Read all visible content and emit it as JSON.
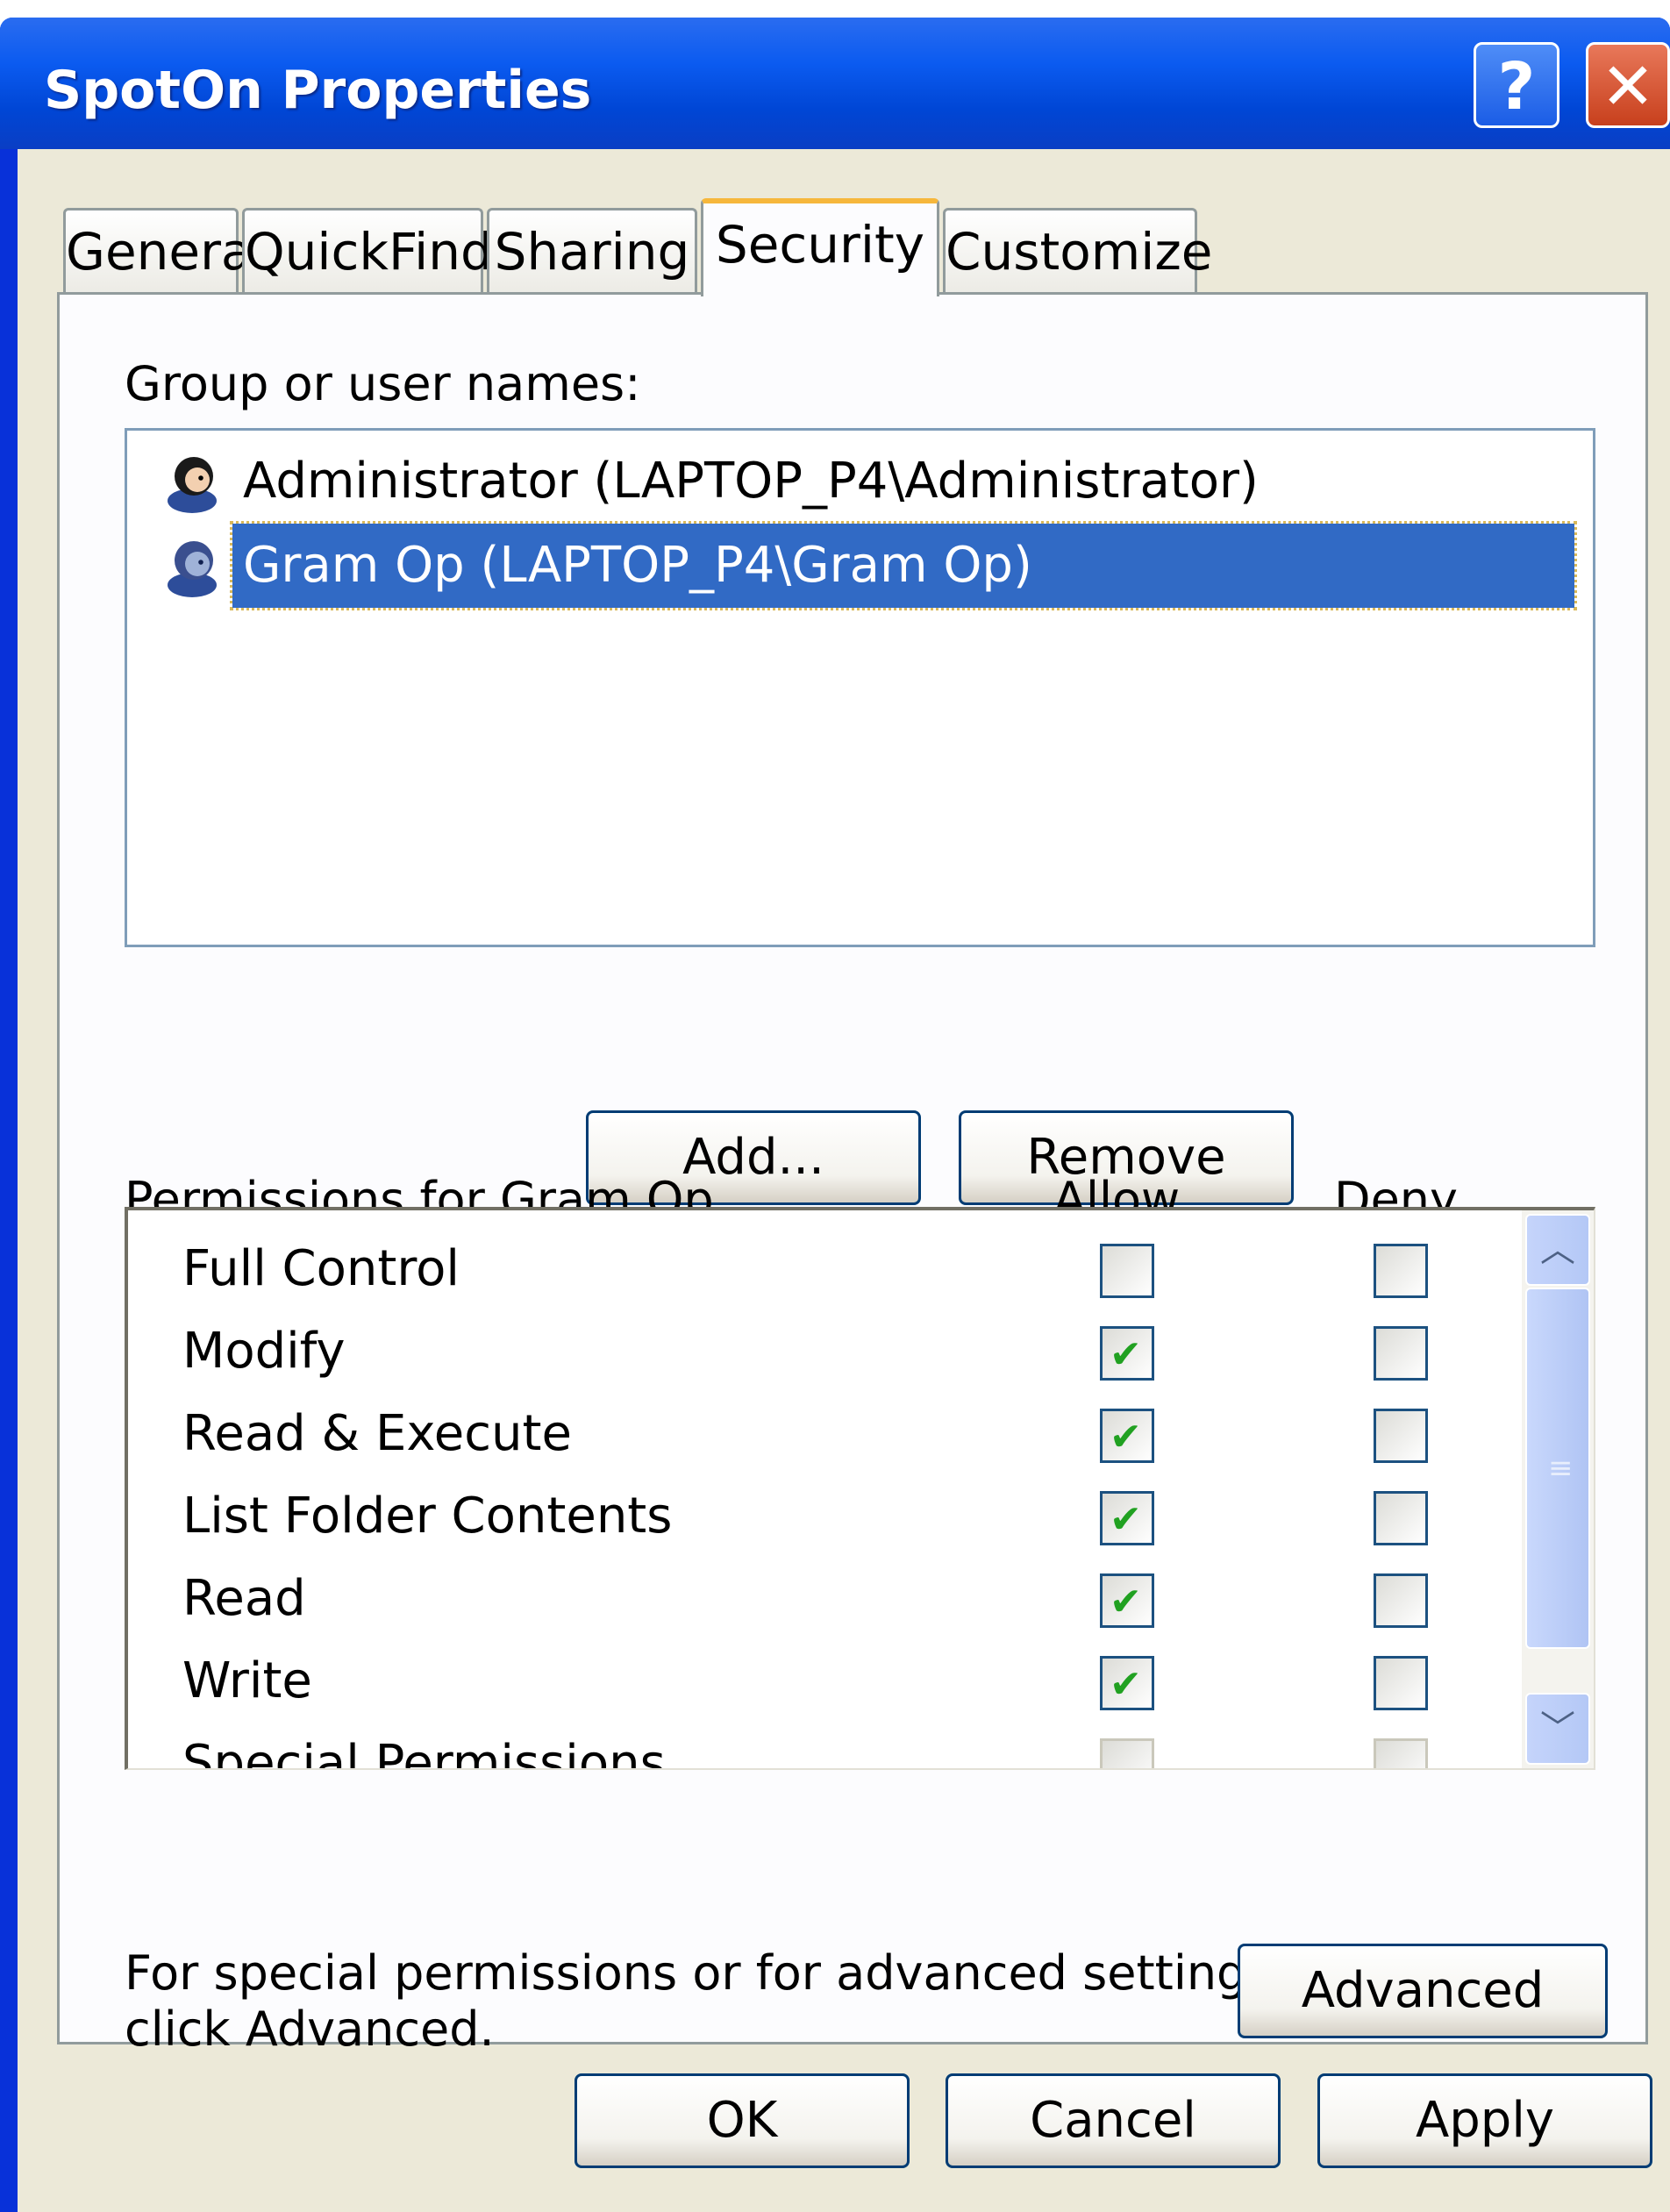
{
  "window": {
    "title": "SpotOn Properties",
    "help_glyph": "?",
    "close_glyph": "✕"
  },
  "tabs": [
    {
      "label": "General"
    },
    {
      "label": "QuickFinder"
    },
    {
      "label": "Sharing"
    },
    {
      "label": "Security",
      "active": true
    },
    {
      "label": "Customize"
    }
  ],
  "security": {
    "group_label": "Group or user names:",
    "users": [
      {
        "name": "Administrator (LAPTOP_P4\\Administrator)",
        "icon": "user-icon"
      },
      {
        "name": "Gram Op (LAPTOP_P4\\Gram Op)",
        "icon": "user-icon",
        "selected": true
      }
    ],
    "add_label": "Add...",
    "remove_label": "Remove",
    "permissions_label": "Permissions for Gram Op",
    "allow_header": "Allow",
    "deny_header": "Deny",
    "permissions": [
      {
        "name": "Full Control",
        "allow": false,
        "deny": false
      },
      {
        "name": "Modify",
        "allow": true,
        "deny": false
      },
      {
        "name": "Read & Execute",
        "allow": true,
        "deny": false
      },
      {
        "name": "List Folder Contents",
        "allow": true,
        "deny": false
      },
      {
        "name": "Read",
        "allow": true,
        "deny": false
      },
      {
        "name": "Write",
        "allow": true,
        "deny": false
      },
      {
        "name": "Special Permissions",
        "allow": false,
        "deny": false
      }
    ],
    "advanced_note_line1": "For special permissions or for advanced settings,",
    "advanced_note_line2": "click Advanced.",
    "advanced_label": "Advanced"
  },
  "footer": {
    "ok_label": "OK",
    "cancel_label": "Cancel",
    "apply_label": "Apply"
  },
  "colors": {
    "selection": "#316ac5",
    "check": "#21a121",
    "titlebar": "#0b5bf0",
    "active_tab_accent": "#f6b73c"
  }
}
